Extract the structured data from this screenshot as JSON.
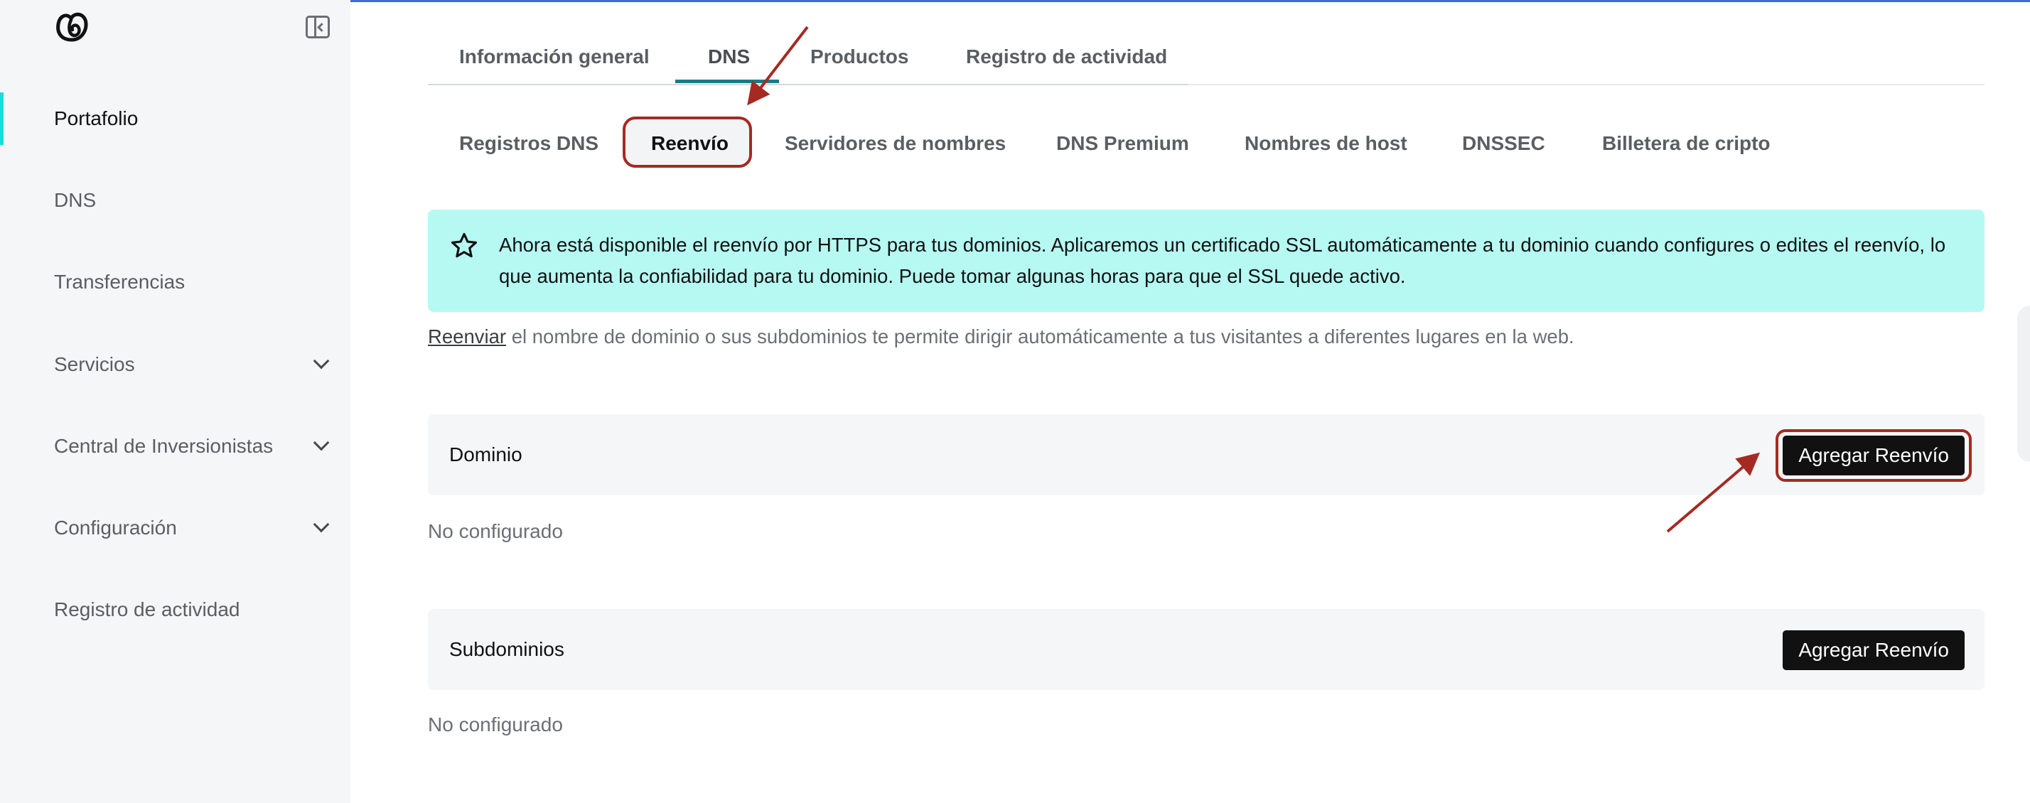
{
  "sidebar": {
    "items": [
      {
        "label": "Portafolio",
        "active": true
      },
      {
        "label": "DNS"
      },
      {
        "label": "Transferencias"
      },
      {
        "label": "Servicios",
        "expandable": true
      },
      {
        "label": "Central de Inversionistas",
        "expandable": true
      },
      {
        "label": "Configuración",
        "expandable": true
      },
      {
        "label": "Registro de actividad"
      }
    ]
  },
  "tabs": [
    {
      "label": "Información general"
    },
    {
      "label": "DNS",
      "active": true
    },
    {
      "label": "Productos"
    },
    {
      "label": "Registro de actividad"
    }
  ],
  "subtabs": [
    {
      "label": "Registros DNS"
    },
    {
      "label": "Reenvío",
      "active": true
    },
    {
      "label": "Servidores de nombres"
    },
    {
      "label": "DNS Premium"
    },
    {
      "label": "Nombres de host"
    },
    {
      "label": "DNSSEC"
    },
    {
      "label": "Billetera de cripto"
    }
  ],
  "banner": {
    "icon": "star-icon",
    "text": "Ahora está disponible el reenvío por HTTPS para tus dominios. Aplicaremos un certificado SSL automáticamente a tu dominio cuando configures o edites el reenvío, lo que aumenta la confiabilidad para tu dominio. Puede tomar algunas horas para que el SSL quede activo.",
    "background": "#b6f9f3"
  },
  "description": {
    "link": "Reenviar",
    "text": " el nombre de dominio o sus subdominios te permite dirigir automáticamente a tus visitantes a diferentes lugares en la web."
  },
  "sections": {
    "domain": {
      "title": "Dominio",
      "button": "Agregar Reenvío",
      "empty": "No configurado"
    },
    "subdomains": {
      "title": "Subdominios",
      "button": "Agregar Reenvío",
      "empty": "No configurado"
    }
  },
  "colors": {
    "accent": "#1b7a87",
    "highlight": "#a52a22",
    "active_nav": "#1bdbdb"
  }
}
